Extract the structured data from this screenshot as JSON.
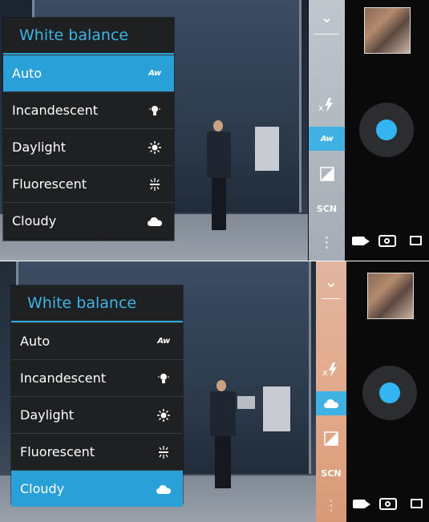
{
  "top_panel": {
    "menu": {
      "title": "White balance",
      "items": [
        {
          "label": "Auto",
          "icon": "auto-wb-icon",
          "selected": true
        },
        {
          "label": "Incandescent",
          "icon": "incandescent-bulb-icon",
          "selected": false
        },
        {
          "label": "Daylight",
          "icon": "sun-icon",
          "selected": false
        },
        {
          "label": "Fluorescent",
          "icon": "fluorescent-icon",
          "selected": false
        },
        {
          "label": "Cloudy",
          "icon": "cloud-icon",
          "selected": false
        }
      ]
    },
    "controls": {
      "flash_icon": "flash-off-icon",
      "active_wb_icon": "auto-wb-icon",
      "exposure_icon": "exposure-icon",
      "scene_label": "SCN",
      "more_icon": "more-vertical-icon"
    }
  },
  "bottom_panel": {
    "menu": {
      "title": "White balance",
      "items": [
        {
          "label": "Auto",
          "icon": "auto-wb-icon",
          "selected": false
        },
        {
          "label": "Incandescent",
          "icon": "incandescent-bulb-icon",
          "selected": false
        },
        {
          "label": "Daylight",
          "icon": "sun-icon",
          "selected": false
        },
        {
          "label": "Fluorescent",
          "icon": "fluorescent-icon",
          "selected": false
        },
        {
          "label": "Cloudy",
          "icon": "cloud-icon",
          "selected": true
        }
      ]
    },
    "controls": {
      "flash_icon": "flash-off-icon",
      "active_wb_icon": "cloud-icon",
      "exposure_icon": "exposure-icon",
      "scene_label": "SCN",
      "more_icon": "more-vertical-icon"
    }
  },
  "icon_glyphs": {
    "auto_wb": "Aw",
    "bulb": "💡",
    "sun": "✹",
    "fluorescent": "⋇",
    "cloud": "☁",
    "flash_off": "✕⚡",
    "exposure": "◪",
    "chevron_down": "⌄",
    "more": "⋮"
  },
  "colors": {
    "accent": "#2aa0d8",
    "title": "#3bb5e8",
    "menu_bg": "#1f2022",
    "shutter": "#33b5f2"
  }
}
